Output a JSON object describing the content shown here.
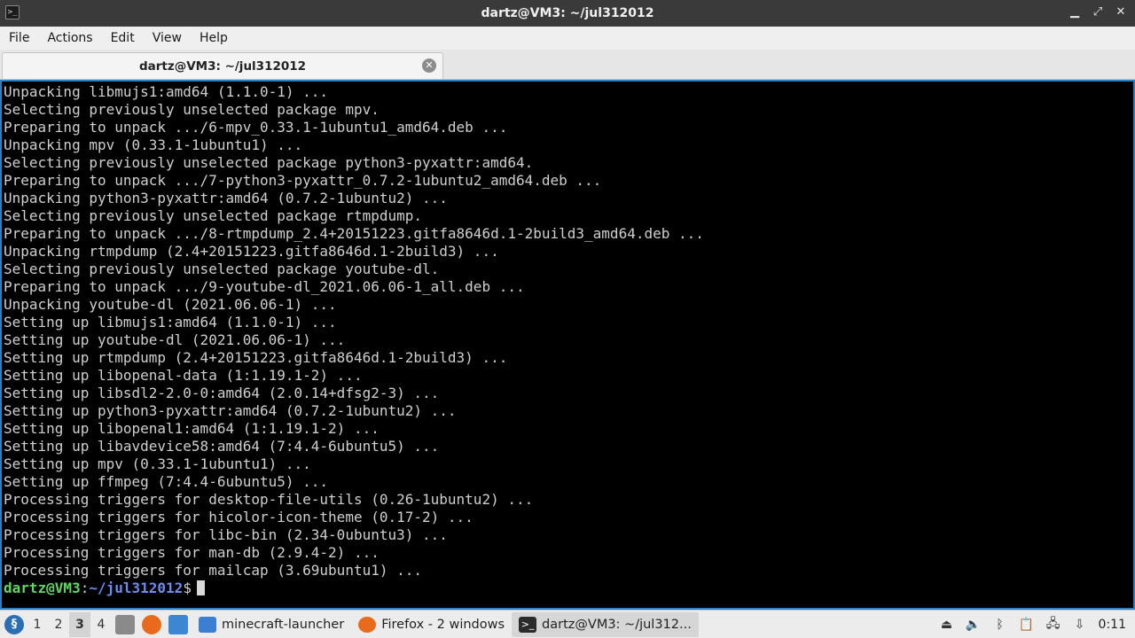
{
  "window": {
    "title": "dartz@VM3: ~/jul312012",
    "buttons": {
      "minimize": "▁",
      "maximize": "⤢",
      "close": "✕"
    }
  },
  "menu": [
    "File",
    "Actions",
    "Edit",
    "View",
    "Help"
  ],
  "tab": {
    "label": "dartz@VM3: ~/jul312012",
    "close_icon": "✕"
  },
  "terminal": {
    "lines": [
      "Unpacking libmujs1:amd64 (1.1.0-1) ...",
      "Selecting previously unselected package mpv.",
      "Preparing to unpack .../6-mpv_0.33.1-1ubuntu1_amd64.deb ...",
      "Unpacking mpv (0.33.1-1ubuntu1) ...",
      "Selecting previously unselected package python3-pyxattr:amd64.",
      "Preparing to unpack .../7-python3-pyxattr_0.7.2-1ubuntu2_amd64.deb ...",
      "Unpacking python3-pyxattr:amd64 (0.7.2-1ubuntu2) ...",
      "Selecting previously unselected package rtmpdump.",
      "Preparing to unpack .../8-rtmpdump_2.4+20151223.gitfa8646d.1-2build3_amd64.deb ...",
      "Unpacking rtmpdump (2.4+20151223.gitfa8646d.1-2build3) ...",
      "Selecting previously unselected package youtube-dl.",
      "Preparing to unpack .../9-youtube-dl_2021.06.06-1_all.deb ...",
      "Unpacking youtube-dl (2021.06.06-1) ...",
      "Setting up libmujs1:amd64 (1.1.0-1) ...",
      "Setting up youtube-dl (2021.06.06-1) ...",
      "Setting up rtmpdump (2.4+20151223.gitfa8646d.1-2build3) ...",
      "Setting up libopenal-data (1:1.19.1-2) ...",
      "Setting up libsdl2-2.0-0:amd64 (2.0.14+dfsg2-3) ...",
      "Setting up python3-pyxattr:amd64 (0.7.2-1ubuntu2) ...",
      "Setting up libopenal1:amd64 (1:1.19.1-2) ...",
      "Setting up libavdevice58:amd64 (7:4.4-6ubuntu5) ...",
      "Setting up mpv (0.33.1-1ubuntu1) ...",
      "Setting up ffmpeg (7:4.4-6ubuntu5) ...",
      "Processing triggers for desktop-file-utils (0.26-1ubuntu2) ...",
      "Processing triggers for hicolor-icon-theme (0.17-2) ...",
      "Processing triggers for libc-bin (2.34-0ubuntu3) ...",
      "Processing triggers for man-db (2.9.4-2) ...",
      "Processing triggers for mailcap (3.69ubuntu1) ..."
    ],
    "prompt": {
      "user_host": "dartz@VM3",
      "separator": ":",
      "path": "~/jul312012",
      "symbol": "$"
    }
  },
  "taskbar": {
    "workspaces": [
      "1",
      "2",
      "3",
      "4"
    ],
    "active_workspace": "3",
    "tasks": [
      {
        "label": "minecraft-launcher",
        "icon": "folder-icon"
      },
      {
        "label": "Firefox - 2 windows",
        "icon": "firefox-icon"
      },
      {
        "label": "dartz@VM3: ~/jul312...",
        "icon": "terminal-icon"
      }
    ],
    "clock": "0:11"
  },
  "colors": {
    "terminal_bg": "#000000",
    "terminal_fg": "#cfcfcf",
    "prompt_user": "#5fd75f",
    "prompt_path": "#6b8cf0",
    "terminal_border": "#2f7fbd",
    "titlebar_bg": "#3a3a3a"
  }
}
